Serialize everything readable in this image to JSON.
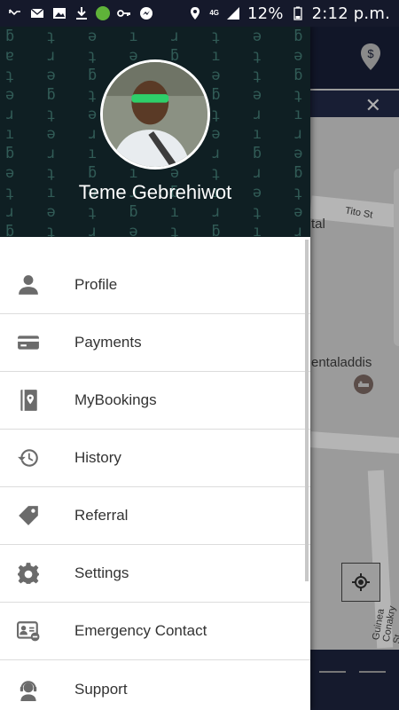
{
  "status_bar": {
    "network": "4G",
    "battery": "12%",
    "time": "2:12 p.m."
  },
  "map": {
    "labels": [
      "tal",
      "Tito St",
      "entaladdis",
      "Guinea Conakry St"
    ],
    "close_icon": "close-icon",
    "pin_icon": "dollar-pin-icon",
    "hotel_icon": "hotel-icon",
    "locate_icon": "my-location-icon"
  },
  "drawer": {
    "user_name": "Teme Gebrehiwot",
    "menu": [
      {
        "label": "Profile",
        "icon": "person-icon"
      },
      {
        "label": "Payments",
        "icon": "credit-card-icon"
      },
      {
        "label": "MyBookings",
        "icon": "book-location-icon"
      },
      {
        "label": "History",
        "icon": "history-icon"
      },
      {
        "label": "Referral",
        "icon": "tag-icon"
      },
      {
        "label": "Settings",
        "icon": "gear-icon"
      },
      {
        "label": "Emergency Contact",
        "icon": "contact-card-icon"
      },
      {
        "label": "Support",
        "icon": "support-agent-icon"
      }
    ]
  }
}
